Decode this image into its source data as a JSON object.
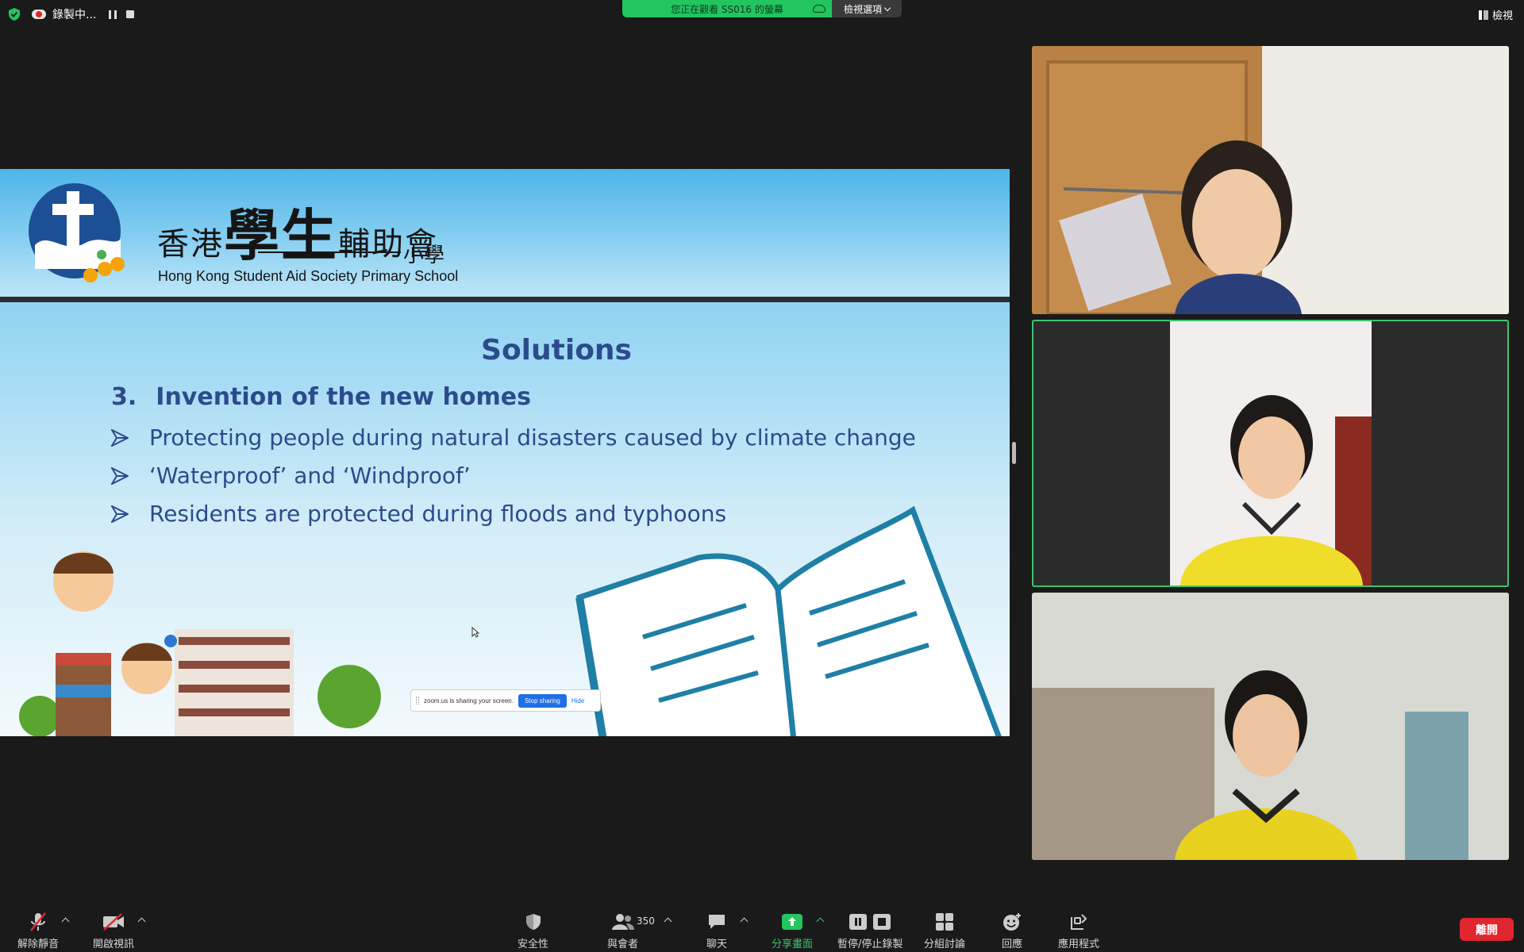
{
  "topbar": {
    "recording_label": "錄製中...",
    "banner_text": "您正在觀看 SS016 的螢幕",
    "view_options_label": "檢視選項",
    "view_label": "檢視"
  },
  "slide": {
    "school_name_cn_part1": "香港",
    "school_name_cn_part2": "學生",
    "school_name_cn_part3": "輔助會",
    "school_name_cn_part4": "小學",
    "school_name_en": "Hong Kong Student Aid Society Primary School",
    "title": "Solutions",
    "subhead_number": "3.",
    "subhead_text": "Invention of the new homes",
    "bullets": [
      "Protecting people during natural disasters caused by climate change",
      "‘Waterproof’ and ‘Windproof’",
      "Residents are protected during floods and typhoons"
    ],
    "sharing_bar": {
      "text": "zoom.us is sharing your screen.",
      "stop_label": "Stop sharing",
      "hide_label": "Hide"
    }
  },
  "toolbar": {
    "unmute_label": "解除靜音",
    "start_video_label": "開啟視訊",
    "security_label": "安全性",
    "participants_label": "與會者",
    "participants_count": "350",
    "chat_label": "聊天",
    "share_label": "分享畫面",
    "record_label": "暫停/停止錄製",
    "breakout_label": "分組討論",
    "reactions_label": "回應",
    "apps_label": "應用程式",
    "leave_label": "離開"
  },
  "colors": {
    "accent_green": "#22c55e",
    "active_speaker_border": "#3ec46d",
    "leave_red": "#e0262e",
    "slide_text": "#2c4b8c",
    "stop_sharing_blue": "#1f6fe5"
  }
}
